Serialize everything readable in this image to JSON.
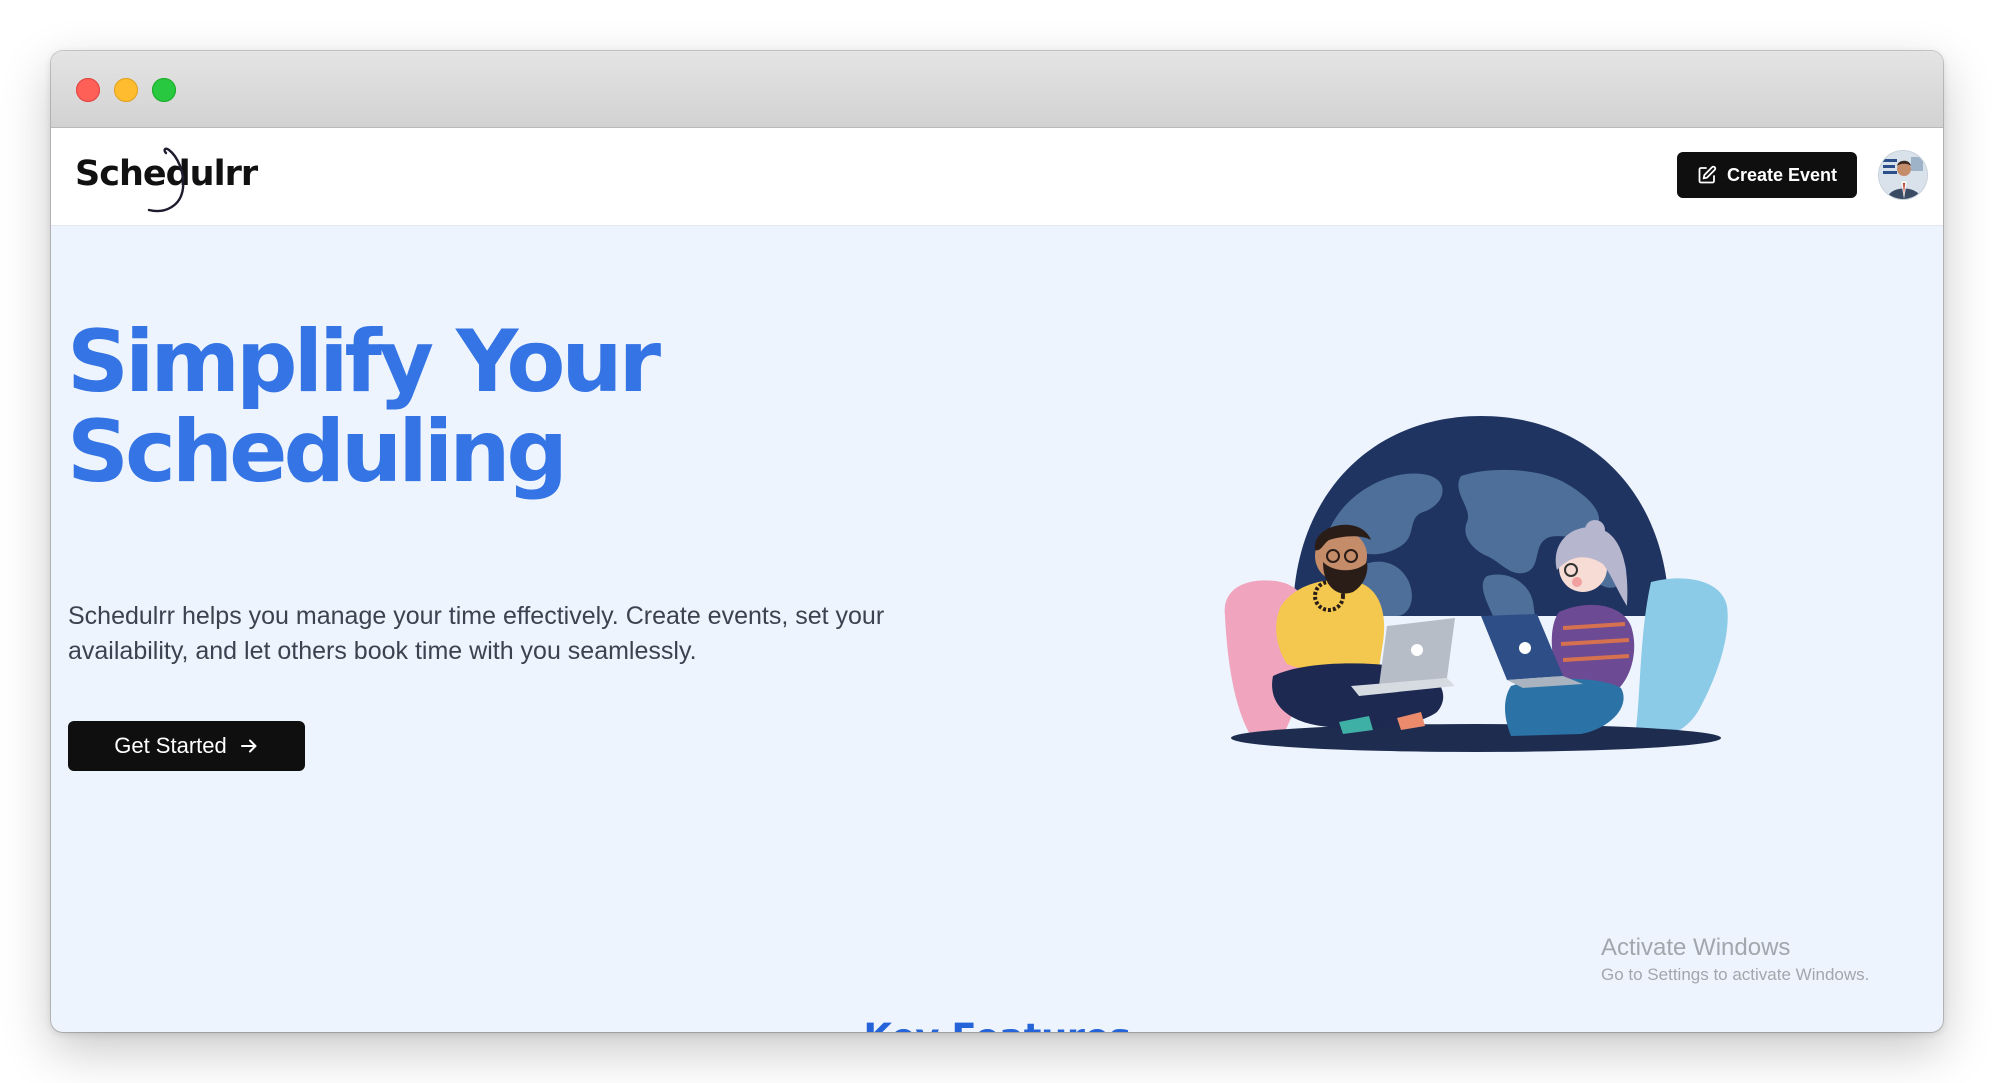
{
  "window": {
    "controls": [
      "close",
      "minimize",
      "zoom"
    ]
  },
  "navbar": {
    "logo_text": "Schedulrr",
    "create_event_label": "Create Event",
    "create_event_icon": "edit-icon",
    "avatar_icon": "user-avatar"
  },
  "hero": {
    "title_line1": "Simplify Your",
    "title_line2": "Scheduling",
    "description": "Schedulrr helps you manage your time effectively. Create events, set your availability, and let others book time with you seamlessly.",
    "cta_label": "Get Started",
    "cta_icon": "arrow-right-icon"
  },
  "overlay": {
    "title": "Activate Windows",
    "subtitle": "Go to Settings to activate Windows."
  },
  "features": {
    "heading": "Key Features"
  },
  "colors": {
    "accent": "#3474e4",
    "heading_blue": "#2563d9",
    "button_dark": "#0f0f0f",
    "page_bg": "#eef4fd"
  }
}
